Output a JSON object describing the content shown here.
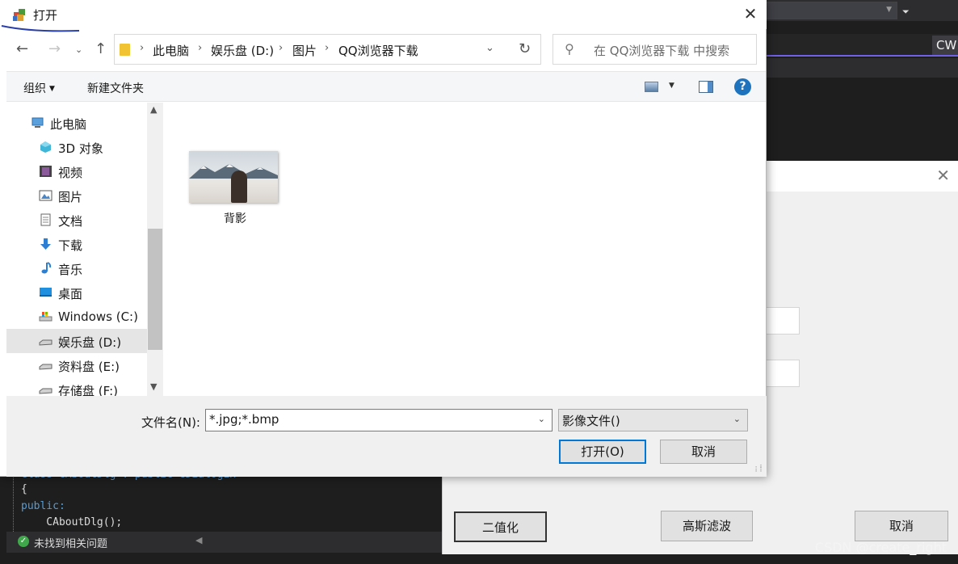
{
  "ide": {
    "cw_label": "CW",
    "code_lines": [
      "class CAboutDlg : public CDialogEx",
      "{",
      "public:",
      "    CAboutDlg();"
    ],
    "status_text": "未找到相关问题"
  },
  "secondary_dialog": {
    "btn_binarize": "二值化",
    "btn_gaussian": "高斯滤波",
    "btn_cancel": "取消"
  },
  "watermark": "CSDN @create_right",
  "open_dialog": {
    "title": "打开",
    "address": {
      "crumbs": [
        "此电脑",
        "娱乐盘 (D:)",
        "图片",
        "QQ浏览器下载"
      ]
    },
    "search_placeholder": "在 QQ浏览器下载 中搜索",
    "toolbar": {
      "organize": "组织",
      "new_folder": "新建文件夹"
    },
    "nav_items": [
      {
        "label": "此电脑",
        "icon": "computer-icon"
      },
      {
        "label": "3D 对象",
        "icon": "3d-objects-icon"
      },
      {
        "label": "视频",
        "icon": "video-icon"
      },
      {
        "label": "图片",
        "icon": "pictures-icon"
      },
      {
        "label": "文档",
        "icon": "documents-icon"
      },
      {
        "label": "下载",
        "icon": "download-icon"
      },
      {
        "label": "音乐",
        "icon": "music-icon"
      },
      {
        "label": "桌面",
        "icon": "desktop-icon"
      },
      {
        "label": "Windows (C:)",
        "icon": "drive-icon"
      },
      {
        "label": "娱乐盘 (D:)",
        "icon": "drive-icon",
        "selected": true
      },
      {
        "label": "资料盘 (E:)",
        "icon": "drive-icon"
      },
      {
        "label": "存储盘 (F:)",
        "icon": "drive-icon"
      }
    ],
    "files": [
      {
        "name": "背影"
      }
    ],
    "filename_label": "文件名(N):",
    "filename_value": "*.jpg;*.bmp",
    "filetype_value": "影像文件()",
    "open_button": "打开(O)",
    "cancel_button": "取消"
  },
  "colors": {
    "accent": "#0078d7",
    "ide_bg": "#1e1e1e",
    "selection": "#e5e5e5"
  }
}
